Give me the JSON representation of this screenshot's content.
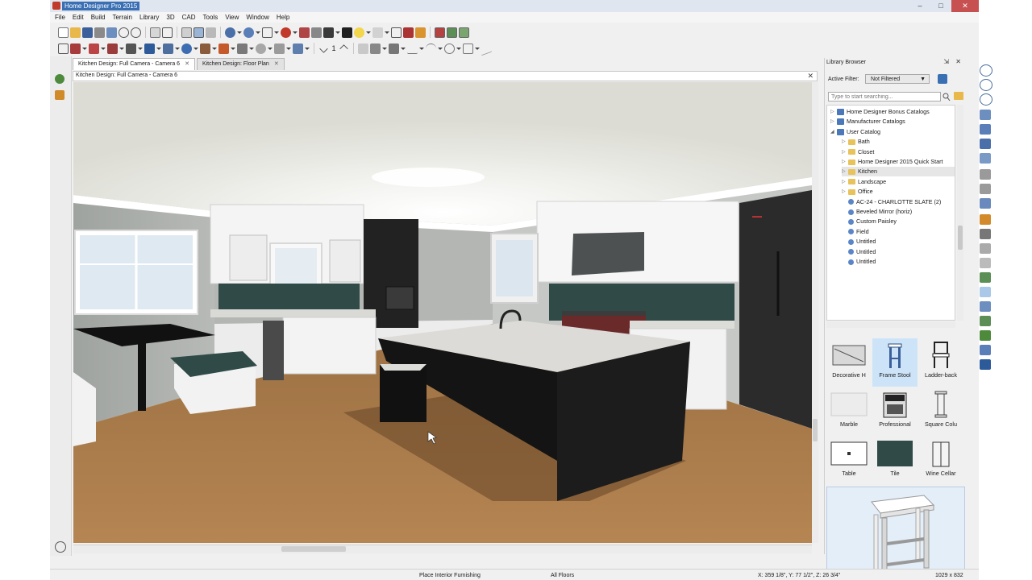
{
  "window": {
    "title": "Home Designer Pro 2015",
    "buttons": [
      "–",
      "□",
      "✕"
    ]
  },
  "menu": [
    "File",
    "Edit",
    "Build",
    "Terrain",
    "Library",
    "3D",
    "CAD",
    "Tools",
    "View",
    "Window",
    "Help"
  ],
  "toolbar2_values": {
    "check_count": "1"
  },
  "tabs": [
    {
      "label": "Kitchen Design: Full Camera - Camera 6",
      "close": "✕",
      "active": true
    },
    {
      "label": "Kitchen Design: Floor Plan",
      "close": "✕",
      "active": false
    }
  ],
  "view": {
    "title": "Kitchen Design: Full Camera - Camera 6",
    "close": "✕"
  },
  "library": {
    "title": "Library Browser",
    "controls": "⇲ ✕",
    "filter_label": "Active Filter:",
    "filter_value": "Not Filtered",
    "search_placeholder": "Type to start searching...",
    "tree": [
      {
        "label": "Home Designer Bonus Catalogs",
        "type": "catalog",
        "level": 0,
        "twisty": "▷"
      },
      {
        "label": "Manufacturer Catalogs",
        "type": "catalog",
        "level": 0,
        "twisty": "▷"
      },
      {
        "label": "User Catalog",
        "type": "catalog",
        "level": 0,
        "twisty": "◢"
      },
      {
        "label": "Bath",
        "type": "folder",
        "level": 1,
        "twisty": "▷"
      },
      {
        "label": "Closet",
        "type": "folder",
        "level": 1,
        "twisty": "▷"
      },
      {
        "label": "Home Designer 2015 Quick Start",
        "type": "folder",
        "level": 1,
        "twisty": "▷"
      },
      {
        "label": "Kitchen",
        "type": "folder",
        "level": 1,
        "twisty": "▷",
        "selected": true
      },
      {
        "label": "Landscape",
        "type": "folder",
        "level": 1,
        "twisty": "▷"
      },
      {
        "label": "Office",
        "type": "folder",
        "level": 1,
        "twisty": "▷"
      },
      {
        "label": "AC-24 - CHARLOTTE SLATE (2)",
        "type": "item",
        "level": 1,
        "twisty": ""
      },
      {
        "label": "Beveled Mirror (horiz)",
        "type": "item",
        "level": 1,
        "twisty": ""
      },
      {
        "label": "Custom Paisley",
        "type": "item",
        "level": 1,
        "twisty": ""
      },
      {
        "label": "Field",
        "type": "item",
        "level": 1,
        "twisty": ""
      },
      {
        "label": "Untitled",
        "type": "item",
        "level": 1,
        "twisty": ""
      },
      {
        "label": "Untitled",
        "type": "item",
        "level": 1,
        "twisty": ""
      },
      {
        "label": "Untitled",
        "type": "item",
        "level": 1,
        "twisty": ""
      }
    ],
    "grid": [
      {
        "label": "Decorative H",
        "icon": "decorative-hood-thumbnail"
      },
      {
        "label": "Frame Stool",
        "icon": "frame-stool-thumbnail",
        "selected": true
      },
      {
        "label": "Ladder-back",
        "icon": "ladder-back-chair-thumbnail"
      },
      {
        "label": "Marble",
        "icon": "marble-material-thumbnail"
      },
      {
        "label": "Professional",
        "icon": "professional-range-thumbnail"
      },
      {
        "label": "Square Colu",
        "icon": "square-column-thumbnail"
      },
      {
        "label": "Table",
        "icon": "table-thumbnail"
      },
      {
        "label": "Tile",
        "icon": "tile-material-thumbnail"
      },
      {
        "label": "Wine Cellar",
        "icon": "wine-cellar-thumbnail"
      }
    ]
  },
  "status": {
    "message": "Place Interior Furnishing",
    "floor": "All Floors",
    "coords": "X: 359 1/8\", Y: 77 1/2\", Z: 26 3/4\"",
    "size": "1029 x 832"
  },
  "colors": {
    "title_highlight": "#3a6fb4",
    "close_button": "#c75050",
    "selected_thumbnail": "#cde4f8",
    "floor": "#a97a46",
    "island": "#141414",
    "backsplash": "#2f4a47"
  }
}
